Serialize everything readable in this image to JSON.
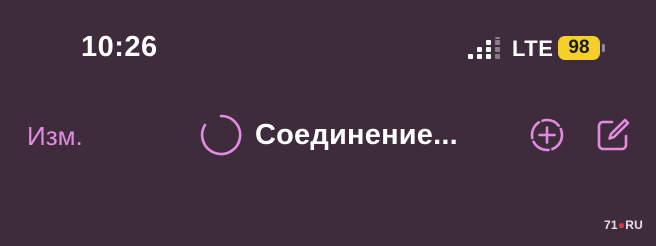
{
  "status_bar": {
    "time": "10:26",
    "network": "LTE",
    "battery_level": "98",
    "battery_color": "#f5cf2a"
  },
  "nav": {
    "edit_label": "Изм.",
    "title": "Соединение...",
    "accent_color": "#e38be0",
    "left_icon": "spinner-icon",
    "right_icons": [
      "new-chat-dashed-plus-icon",
      "compose-icon"
    ]
  },
  "watermark": {
    "prefix": "71",
    "dot": "●",
    "suffix": "RU"
  }
}
